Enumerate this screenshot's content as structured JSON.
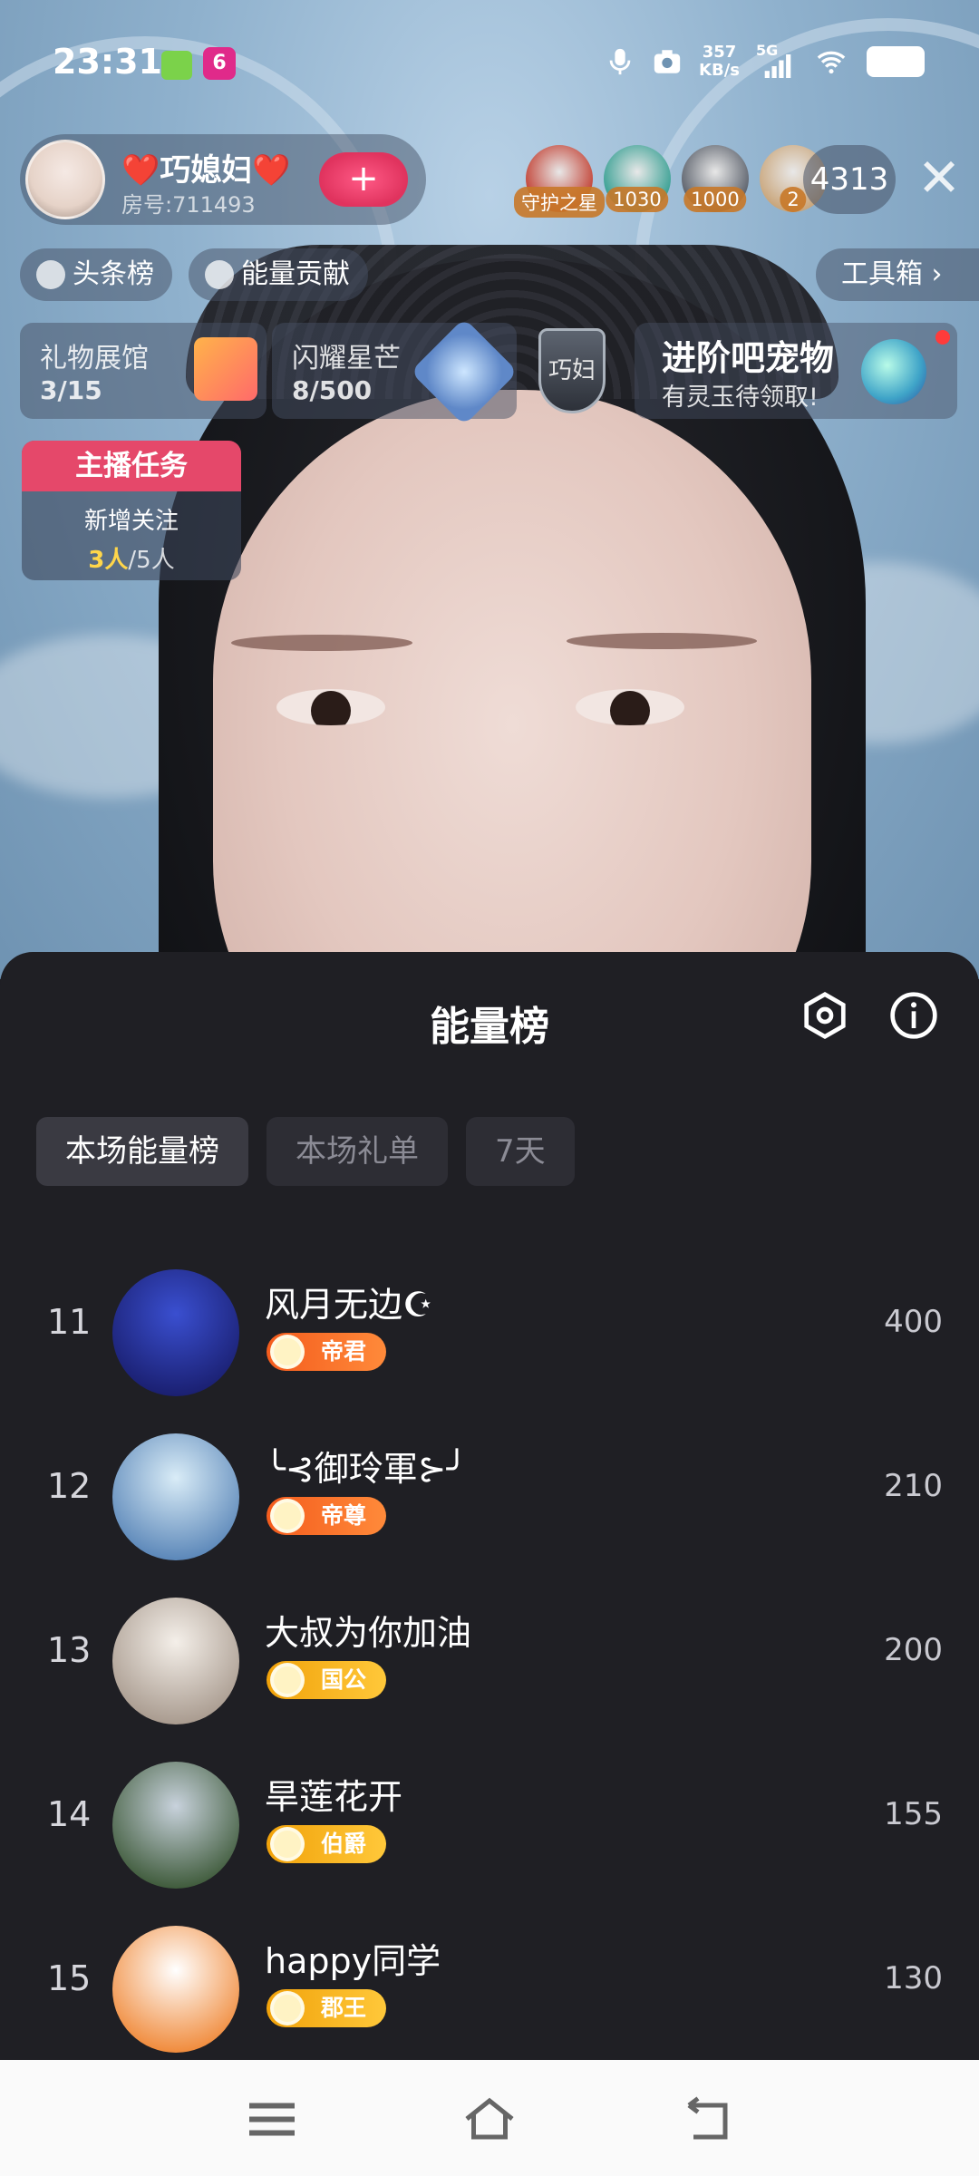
{
  "status_bar": {
    "time": "23:31",
    "app_badge": "6",
    "net_speed_value": "357",
    "net_speed_unit": "KB/s",
    "network": "5G"
  },
  "host": {
    "name": "❤️巧媳妇❤️",
    "room": "房号:711493",
    "follow_label": "+"
  },
  "viewers": [
    {
      "tag": "守护之星",
      "color": "#c0392b"
    },
    {
      "tag": "1030",
      "color": "#2f9c8f"
    },
    {
      "tag": "1000",
      "color": "#555b66"
    },
    {
      "tag": "2",
      "color": "#c9a57a"
    }
  ],
  "viewer_count": "4313",
  "close_label": "✕",
  "rank_chips": {
    "headline": "头条榜",
    "energy": "能量贡献",
    "toolbox": "工具箱 ›"
  },
  "activities": {
    "gift_hall": {
      "title": "礼物展馆",
      "value": "3/15"
    },
    "shine_star": {
      "title": "闪耀星芒",
      "value": "8/500"
    },
    "shield_text": "巧妇",
    "pet": {
      "title": "进阶吧宠物",
      "subtitle": "有灵玉待领取!"
    }
  },
  "task": {
    "header": "主播任务",
    "label": "新增关注",
    "current": "3人",
    "target": "/5人"
  },
  "sheet": {
    "title": "能量榜",
    "tabs": [
      "本场能量榜",
      "本场礼单",
      "7天"
    ],
    "active_tab": 0
  },
  "ranking": [
    {
      "rank": "11",
      "name": "风月无边☪",
      "badge": "帝君",
      "badge_style": "orange",
      "score": "400",
      "avatar": [
        "#3a4fd0",
        "#1a1f70"
      ]
    },
    {
      "rank": "12",
      "name": "╰⊰御玲軍⊱╯",
      "badge": "帝尊",
      "badge_style": "orange",
      "score": "210",
      "avatar": [
        "#d9ecf7",
        "#5a86b8"
      ]
    },
    {
      "rank": "13",
      "name": "大叔为你加油",
      "badge": "国公",
      "badge_style": "gold",
      "score": "200",
      "avatar": [
        "#f4efe9",
        "#a89a8e"
      ]
    },
    {
      "rank": "14",
      "name": "旱莲花开",
      "badge": "伯爵",
      "badge_style": "gold",
      "score": "155",
      "avatar": [
        "#c8d2dc",
        "#3e5a3a"
      ]
    },
    {
      "rank": "15",
      "name": "happy同学",
      "badge": "郡王",
      "badge_style": "gold",
      "score": "130",
      "avatar": [
        "#ffffff",
        "#f08a3a"
      ]
    }
  ],
  "colors": {
    "sheet_bg": "#1f1f24",
    "accent_pink": "#e5486a",
    "badge_orange": "#f45c1d",
    "badge_gold": "#f1a20a"
  }
}
